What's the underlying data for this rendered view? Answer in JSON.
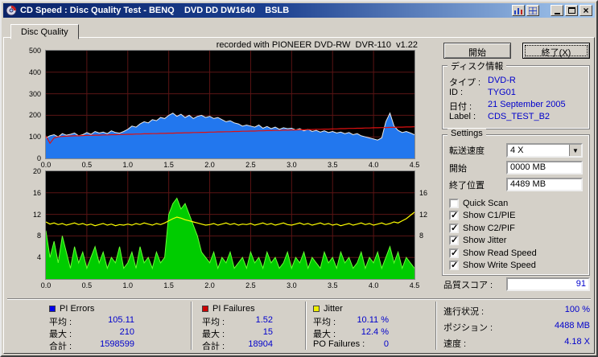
{
  "colors": {
    "value_text": "#0000cc",
    "titlebar": "#0a246a",
    "chart_bg": "#000000"
  },
  "window": {
    "title": "CD Speed : Disc Quality Test - BENQ    DVD DD DW1640    BSLB"
  },
  "tabs": {
    "disc_quality": "Disc Quality"
  },
  "actions": {
    "start": "開始",
    "exit": "終了(X)"
  },
  "disc_info": {
    "title": "ディスク情報",
    "rows": [
      {
        "label": "タイプ :",
        "value": "DVD-R"
      },
      {
        "label": "ID :",
        "value": "TYG01"
      },
      {
        "label": "日付 :",
        "value": "21 September 2005"
      },
      {
        "label": "Label :",
        "value": "CDS_TEST_B2"
      }
    ]
  },
  "settings": {
    "title": "Settings",
    "speed_label": "転送速度",
    "speed_value": "4 X",
    "start_label": "開始",
    "start_value": "0000 MB",
    "end_label": "終了位置",
    "end_value": "4489 MB",
    "checkboxes": [
      {
        "label": "Quick Scan",
        "checked": false
      },
      {
        "label": "Show C1/PIE",
        "checked": true
      },
      {
        "label": "Show C2/PIF",
        "checked": true
      },
      {
        "label": "Show Jitter",
        "checked": true
      },
      {
        "label": "Show Read Speed",
        "checked": true
      },
      {
        "label": "Show Write Speed",
        "checked": true
      }
    ]
  },
  "quality": {
    "label": "品質スコア :",
    "value": "91"
  },
  "progress": {
    "rows": [
      {
        "label": "進行状況 :",
        "value": "100 %"
      },
      {
        "label": "ポジション :",
        "value": "4488 MB"
      },
      {
        "label": "速度 :",
        "value": "4.18 X"
      }
    ]
  },
  "stats": {
    "groups": [
      {
        "name": "PI Errors",
        "color": "#0000ee",
        "rows": [
          {
            "label": "平均 :",
            "value": "105.11"
          },
          {
            "label": "最大 :",
            "value": "210"
          },
          {
            "label": "合計 :",
            "value": "1598599"
          }
        ]
      },
      {
        "name": "PI Failures",
        "color": "#cc0000",
        "rows": [
          {
            "label": "平均 :",
            "value": "1.52"
          },
          {
            "label": "最大 :",
            "value": "15"
          },
          {
            "label": "合計 :",
            "value": "18904"
          }
        ]
      },
      {
        "name": "Jitter",
        "color": "#eeee00",
        "rows": [
          {
            "label": "平均 :",
            "value": "10.11 %"
          },
          {
            "label": "最大 :",
            "value": "12.4 %"
          },
          {
            "label": "PO Failures :",
            "value": "0"
          }
        ]
      }
    ]
  },
  "chart_data": [
    {
      "type": "area",
      "title": "recorded with PIONEER DVD-RW  DVR-110  v1.22",
      "xlabel": "",
      "xlim": [
        0,
        4.5
      ],
      "x_ticks": [
        "0.0",
        "0.5",
        "1.0",
        "1.5",
        "2.0",
        "2.5",
        "3.0",
        "3.5",
        "4.0",
        "4.5"
      ],
      "ylim": [
        0,
        500
      ],
      "y_ticks_left": [
        500,
        400,
        300,
        200,
        100,
        0
      ],
      "y_ticks_right": [],
      "bg": "#000000",
      "grid": "#5a1414",
      "series": [
        {
          "name": "PI Errors (C1/PIE)",
          "type": "area",
          "color": "#2277ee",
          "edge": "#e8e8e8",
          "values": [
            95,
            105,
            110,
            100,
            115,
            108,
            112,
            118,
            105,
            110,
            120,
            112,
            125,
            118,
            122,
            115,
            128,
            120,
            117,
            125,
            135,
            150,
            145,
            160,
            170,
            165,
            180,
            175,
            190,
            185,
            200,
            210,
            195,
            205,
            190,
            200,
            185,
            195,
            200,
            190,
            195,
            185,
            190,
            180,
            170,
            175,
            165,
            160,
            150,
            155,
            150,
            145,
            155,
            140,
            148,
            138,
            145,
            135,
            142,
            138,
            140,
            132,
            138,
            128,
            135,
            125,
            130,
            122,
            128,
            120,
            125,
            118,
            122,
            115,
            120,
            110,
            115,
            105,
            100,
            95,
            90,
            85,
            95,
            170,
            210,
            150,
            130,
            120,
            125,
            118,
            110
          ]
        },
        {
          "name": "Write Speed",
          "type": "line",
          "color": "#e01010",
          "values": [
            105,
            70,
            95,
            100,
            102,
            103,
            104,
            105,
            105,
            106,
            107,
            107,
            108,
            108,
            109,
            109,
            110,
            110,
            111,
            111,
            112,
            112,
            113,
            113,
            114,
            114,
            115,
            115,
            116,
            116,
            117,
            117,
            118,
            118,
            119,
            119,
            120,
            120,
            121,
            121,
            122,
            122,
            123,
            123,
            124,
            124,
            125,
            125,
            126,
            126,
            127,
            127,
            128,
            128,
            129,
            129,
            130,
            130,
            131,
            131,
            132,
            132,
            133,
            133,
            134,
            134,
            135,
            135,
            136,
            136,
            137,
            137,
            138,
            138,
            139,
            139,
            140,
            140,
            141,
            141,
            142,
            142,
            143,
            143,
            144,
            144,
            145,
            145,
            146,
            146,
            147
          ]
        }
      ]
    },
    {
      "type": "area",
      "title": "",
      "xlabel": "",
      "xlim": [
        0,
        4.5
      ],
      "x_ticks": [
        "0.0",
        "0.5",
        "1.0",
        "1.5",
        "2.0",
        "2.5",
        "3.0",
        "3.5",
        "4.0",
        "4.5"
      ],
      "ylim": [
        0,
        20
      ],
      "y_ticks_left": [
        20,
        16,
        12,
        8,
        4
      ],
      "y_ticks_right": [
        16,
        12,
        8
      ],
      "bg": "#000000",
      "grid": "#5a1414",
      "series": [
        {
          "name": "PI Failures (C2/PIF)",
          "type": "area",
          "color": "#00cc00",
          "edge": "#66ff33",
          "values": [
            9,
            4,
            7,
            3,
            8,
            5,
            2,
            6,
            3,
            5,
            2,
            4,
            6,
            3,
            5,
            2,
            4,
            3,
            6,
            2,
            3,
            5,
            2,
            6,
            3,
            4,
            2,
            5,
            3,
            4,
            12,
            14,
            15,
            13,
            14,
            12,
            10,
            8,
            5,
            4,
            3,
            5,
            2,
            4,
            3,
            5,
            2,
            3,
            4,
            2,
            5,
            3,
            4,
            2,
            5,
            3,
            4,
            2,
            3,
            5,
            2,
            4,
            3,
            5,
            2,
            4,
            3,
            2,
            5,
            3,
            4,
            2,
            5,
            3,
            4,
            2,
            3,
            5,
            2,
            4,
            3,
            5,
            2,
            4,
            6,
            3,
            5,
            2,
            4,
            3,
            2
          ]
        },
        {
          "name": "Jitter",
          "type": "line",
          "color": "#ffff00",
          "values": [
            10.6,
            10.2,
            10.4,
            10.1,
            10.3,
            10.0,
            10.2,
            10.4,
            10.1,
            10.3,
            10.0,
            10.2,
            9.9,
            10.1,
            10.3,
            10.0,
            10.2,
            9.9,
            10.1,
            10.0,
            10.2,
            10.0,
            10.3,
            10.1,
            10.4,
            10.2,
            10.0,
            10.3,
            10.1,
            10.4,
            10.8,
            11.2,
            11.5,
            11.3,
            11.0,
            10.8,
            10.6,
            10.4,
            10.2,
            10.0,
            10.1,
            10.3,
            10.0,
            10.2,
            10.4,
            10.1,
            10.3,
            10.0,
            10.2,
            10.1,
            10.3,
            10.0,
            10.2,
            10.4,
            10.1,
            10.3,
            10.0,
            10.2,
            10.4,
            10.1,
            10.0,
            10.2,
            10.4,
            10.1,
            10.3,
            10.0,
            10.2,
            10.4,
            10.1,
            10.3,
            10.0,
            10.2,
            9.9,
            10.1,
            10.3,
            10.0,
            10.2,
            10.4,
            10.1,
            10.3,
            10.0,
            10.2,
            10.4,
            10.1,
            10.3,
            10.6,
            10.4,
            10.8,
            11.2,
            11.8,
            12.4
          ]
        }
      ]
    }
  ]
}
